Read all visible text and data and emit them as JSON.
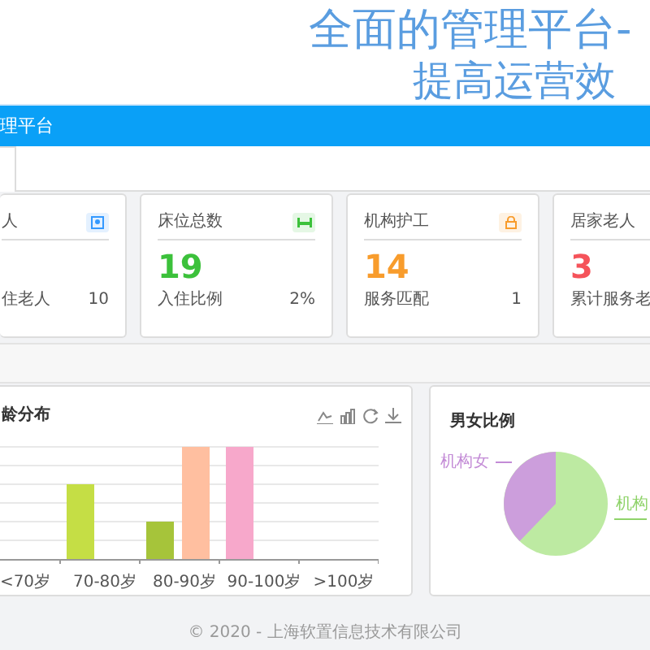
{
  "banner": {
    "title_line_1": "全面的管理平台-",
    "title_line_2": "提高运营效"
  },
  "header": {
    "title": "理平台"
  },
  "stat_cards": [
    {
      "title": "人",
      "kind": "person",
      "color": "#3399ff",
      "caption": "住老人",
      "caption_value": "10"
    },
    {
      "title": "床位总数",
      "kind": "bed",
      "color": "#3cc13b",
      "value": "19",
      "caption": "入住比例",
      "caption_value": "2%"
    },
    {
      "title": "机构护工",
      "kind": "lock",
      "color": "#f89c2c",
      "value": "14",
      "caption": "服务匹配",
      "caption_value": "1"
    },
    {
      "title": "居家老人",
      "color": "#f5535a",
      "value": "3",
      "caption": "累计服务老"
    }
  ],
  "age_chart": {
    "title": "龄分布",
    "categories": [
      "<70岁",
      "70-80岁",
      "80-90岁",
      "90-100岁",
      ">100岁"
    ]
  },
  "gender_chart": {
    "title": "男女比例",
    "labels": [
      "机构女",
      "机构"
    ]
  },
  "footer": {
    "text": "© 2020 - 上海软置信息技术有限公司"
  }
}
